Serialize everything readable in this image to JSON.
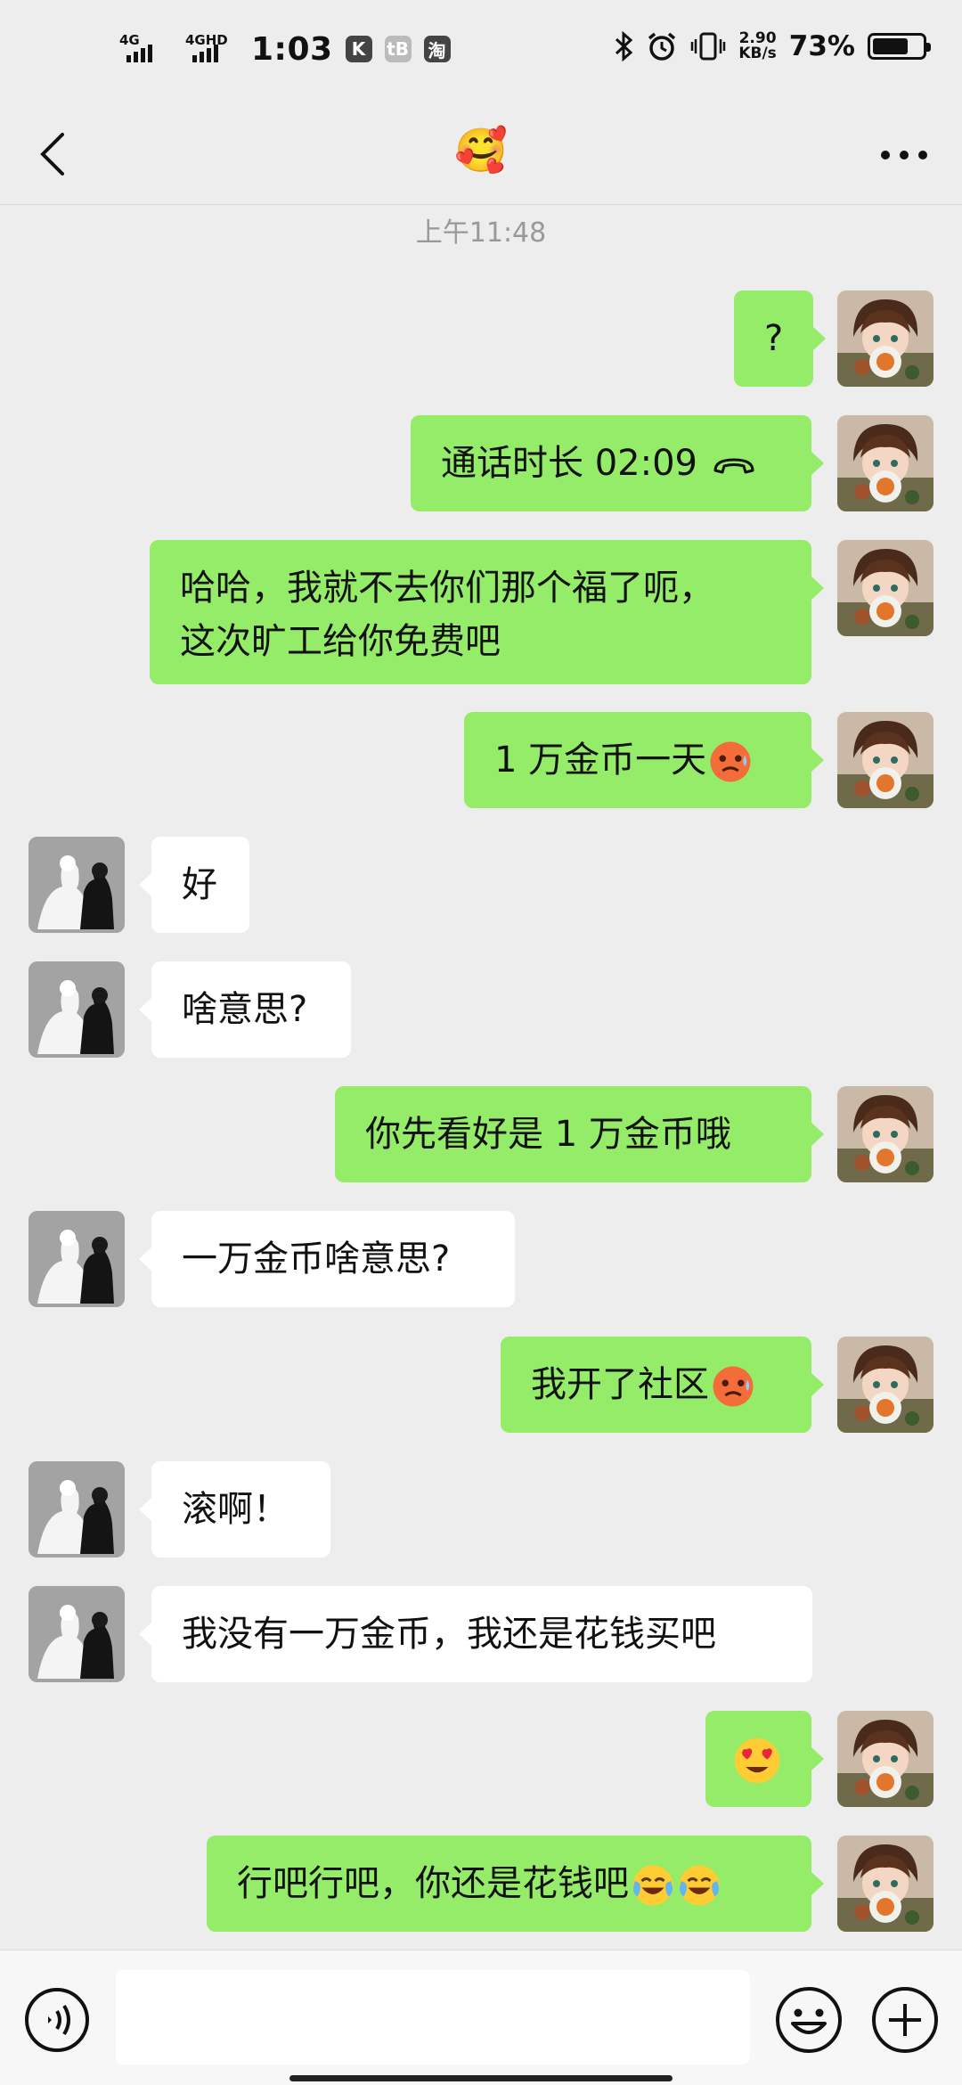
{
  "status_bar": {
    "sim1_label": "4G",
    "sim2_label": "4GHD",
    "time": "1:03",
    "app1": "K",
    "app2": "tB",
    "app3": "淘",
    "speed_value": "2.90",
    "speed_unit": "KB/s",
    "battery_percent": "73%",
    "battery_level": 0.73
  },
  "header": {
    "title": "🥰"
  },
  "chat": {
    "timestamp": "上午11:48",
    "messages": [
      {
        "text": "?"
      },
      {
        "text": "通话时长 02:09"
      },
      {
        "line1": "哈哈，我就不去你们那个福了呃，",
        "line2": "这次旷工给你免费吧"
      },
      {
        "text": "1 万金币一天"
      },
      {
        "text": "好"
      },
      {
        "text": "啥意思?"
      },
      {
        "text": "你先看好是 1 万金币哦"
      },
      {
        "text": "一万金币啥意思?"
      },
      {
        "text": "我开了社区"
      },
      {
        "text": "滚啊！"
      },
      {
        "text": "我没有一万金币，我还是花钱买吧"
      },
      {
        "text": ""
      },
      {
        "text": "行吧行吧，你还是花钱吧"
      }
    ]
  },
  "input": {
    "placeholder": ""
  },
  "colors": {
    "sent_bubble": "#95ec69",
    "recv_bubble": "#ffffff",
    "background": "#ededed"
  }
}
